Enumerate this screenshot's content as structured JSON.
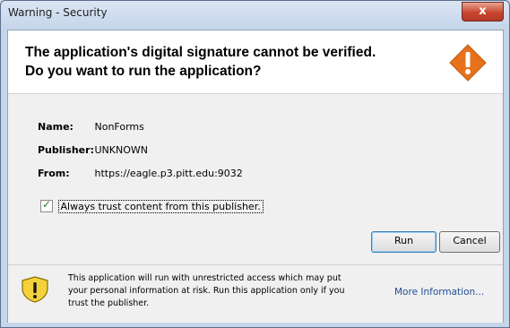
{
  "window": {
    "title": "Warning - Security",
    "close_label": "x"
  },
  "header": {
    "line1": "The application's digital signature cannot be verified.",
    "line2": "Do you want to run the application?"
  },
  "details": [
    {
      "label": "Name:",
      "value": "NonForms"
    },
    {
      "label": "Publisher:",
      "value": "UNKNOWN"
    },
    {
      "label": "From:",
      "value": "https://eagle.p3.pitt.edu:9032"
    }
  ],
  "checkbox": {
    "label": "Always trust content from this publisher.",
    "checked": true
  },
  "buttons": {
    "run": "Run",
    "cancel": "Cancel"
  },
  "footer": {
    "text_line1": "This application will run with unrestricted access which may put",
    "text_line2": "your personal information at risk. Run this application only if you",
    "text_line3": "trust the publisher.",
    "more_info": "More Information..."
  },
  "icons": {
    "header": "warning-diamond-icon",
    "footer": "shield-warning-icon",
    "checkbox": "checkmark-icon"
  },
  "colors": {
    "warning_orange": "#e8711c",
    "shield_yellow": "#f3d23a",
    "link": "#1f4e9a"
  }
}
